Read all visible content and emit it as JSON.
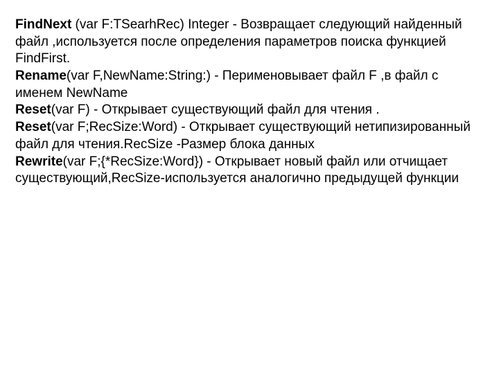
{
  "entries": [
    {
      "name": "FindNext",
      "sig": " (var F:TSearhRec) Integer -  Возвращает следующий найденный файл ,используется после определения параметров поиска функцией FindFirst."
    },
    {
      "name": "Rename",
      "sig": "(var F,NewName:String:) -  Перименовывает  файл F  ,в файл с именем NewName"
    },
    {
      "name": "Reset",
      "sig": "(var F) -  Открывает существующий файл для чтения ."
    },
    {
      "name": "Reset",
      "sig": "(var F;RecSize:Word)  -  Открывает существующий нетипизированный файл для чтения.RecSize -Размер блока данных"
    },
    {
      "name": "Rewrite",
      "sig": "(var F;{*RecSize:Word})  - Открывает новый файл или отчищает существующий,RecSize-используется аналогично предыдущей  функции"
    }
  ]
}
